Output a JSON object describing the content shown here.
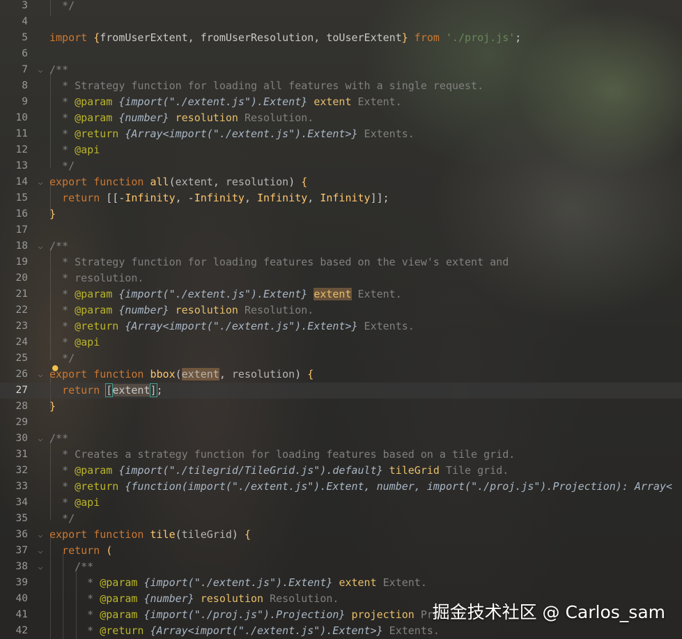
{
  "watermark": "掘金技术社区 @ Carlos_sam",
  "lines": [
    {
      "n": "3",
      "fold": "",
      "current": false,
      "html": "<span class=\"cm\">  */</span>"
    },
    {
      "n": "4",
      "fold": "",
      "current": false,
      "html": ""
    },
    {
      "n": "5",
      "fold": "",
      "current": false,
      "html": "<span class=\"kw\">import</span> <span class=\"fn\">{</span>fromUserExtent, fromUserResolution, toUserExtent<span class=\"fn\">}</span> <span class=\"kw\">from</span> <span class=\"str\">'./proj.js'</span>;"
    },
    {
      "n": "6",
      "fold": "",
      "current": false,
      "html": ""
    },
    {
      "n": "7",
      "fold": "⌵",
      "current": false,
      "html": "<span class=\"cm\">/**</span>"
    },
    {
      "n": "8",
      "fold": "",
      "current": false,
      "html": "<span class=\"cm\">  * Strategy function for loading all features with a single request.</span>"
    },
    {
      "n": "9",
      "fold": "",
      "current": false,
      "html": "<span class=\"cm\">  * </span><span class=\"tag\">@param</span> <span class=\"ty\">{import(\"./extent.js\").Extent}</span> <span class=\"pn\">extent</span> <span class=\"cm\">Extent.</span>"
    },
    {
      "n": "10",
      "fold": "",
      "current": false,
      "html": "<span class=\"cm\">  * </span><span class=\"tag\">@param</span> <span class=\"ty\">{number}</span> <span class=\"pn\">resolution</span> <span class=\"cm\">Resolution.</span>"
    },
    {
      "n": "11",
      "fold": "",
      "current": false,
      "html": "<span class=\"cm\">  * </span><span class=\"tag\">@return</span> <span class=\"ty\">{Array&lt;import(\"./extent.js\").Extent&gt;}</span> <span class=\"cm\">Extents.</span>"
    },
    {
      "n": "12",
      "fold": "",
      "current": false,
      "html": "<span class=\"cm\">  * </span><span class=\"tag\">@api</span>"
    },
    {
      "n": "13",
      "fold": "",
      "current": false,
      "html": "<span class=\"cm\">  */</span>"
    },
    {
      "n": "14",
      "fold": "⌵",
      "current": false,
      "html": "<span class=\"kw\">export</span> <span class=\"kw\">function</span> <span class=\"fn\">all</span>(<span class=\"par\">extent</span>, <span class=\"par\">resolution</span>) <span class=\"fn\">{</span>"
    },
    {
      "n": "15",
      "fold": "",
      "current": false,
      "html": "  <span class=\"kw\">return</span> [[-<span class=\"fn\">Infinity</span>, -<span class=\"fn\">Infinity</span>, <span class=\"fn\">Infinity</span>, <span class=\"fn\">Infinity</span>]];"
    },
    {
      "n": "16",
      "fold": "",
      "current": false,
      "html": "<span class=\"fn\">}</span>"
    },
    {
      "n": "17",
      "fold": "",
      "current": false,
      "html": ""
    },
    {
      "n": "18",
      "fold": "⌵",
      "current": false,
      "html": "<span class=\"cm\">/**</span>"
    },
    {
      "n": "19",
      "fold": "",
      "current": false,
      "html": "<span class=\"cm\">  * Strategy function for loading features based on the view's extent and</span>"
    },
    {
      "n": "20",
      "fold": "",
      "current": false,
      "html": "<span class=\"cm\">  * resolution.</span>"
    },
    {
      "n": "21",
      "fold": "",
      "current": false,
      "html": "<span class=\"cm\">  * </span><span class=\"tag\">@param</span> <span class=\"ty\">{import(\"./extent.js\").Extent}</span> <span class=\"pn hl\">extent</span> <span class=\"cm\">Extent.</span>"
    },
    {
      "n": "22",
      "fold": "",
      "current": false,
      "html": "<span class=\"cm\">  * </span><span class=\"tag\">@param</span> <span class=\"ty\">{number}</span> <span class=\"pn\">resolution</span> <span class=\"cm\">Resolution.</span>"
    },
    {
      "n": "23",
      "fold": "",
      "current": false,
      "html": "<span class=\"cm\">  * </span><span class=\"tag\">@return</span> <span class=\"ty\">{Array&lt;import(\"./extent.js\").Extent&gt;}</span> <span class=\"cm\">Extents.</span>"
    },
    {
      "n": "24",
      "fold": "",
      "current": false,
      "html": "<span class=\"cm\">  * </span><span class=\"tag\">@api</span>"
    },
    {
      "n": "25",
      "fold": "",
      "current": false,
      "html": "<span class=\"cm\">  */</span>"
    },
    {
      "n": "26",
      "fold": "⌵",
      "current": false,
      "html": "<span class=\"kw\">export</span> <span class=\"kw\">function</span> <span class=\"fn\">bbox</span>(<span class=\"par hl\">extent</span>, <span class=\"par\">resolution</span>) <span class=\"fn\">{</span>"
    },
    {
      "n": "27",
      "fold": "",
      "current": true,
      "html": "  <span class=\"kw\">return</span> <span class=\"br\">[</span><span class=\"bl\">extent</span><span class=\"br\">]</span>;"
    },
    {
      "n": "28",
      "fold": "",
      "current": false,
      "html": "<span class=\"fn\">}</span>"
    },
    {
      "n": "29",
      "fold": "",
      "current": false,
      "html": ""
    },
    {
      "n": "30",
      "fold": "⌵",
      "current": false,
      "html": "<span class=\"cm\">/**</span>"
    },
    {
      "n": "31",
      "fold": "",
      "current": false,
      "html": "<span class=\"cm\">  * Creates a strategy function for loading features based on a tile grid.</span>"
    },
    {
      "n": "32",
      "fold": "",
      "current": false,
      "html": "<span class=\"cm\">  * </span><span class=\"tag\">@param</span> <span class=\"ty\">{import(\"./tilegrid/TileGrid.js\").default}</span> <span class=\"pn\">tileGrid</span> <span class=\"cm\">Tile grid.</span>"
    },
    {
      "n": "33",
      "fold": "",
      "current": false,
      "html": "<span class=\"cm\">  * </span><span class=\"tag\">@return</span> <span class=\"ty\">{function(import(\"./extent.js\").Extent, number, import(\"./proj.js\").Projection): Array&lt;</span>"
    },
    {
      "n": "34",
      "fold": "",
      "current": false,
      "html": "<span class=\"cm\">  * </span><span class=\"tag\">@api</span>"
    },
    {
      "n": "35",
      "fold": "",
      "current": false,
      "html": "<span class=\"cm\">  */</span>"
    },
    {
      "n": "36",
      "fold": "⌵",
      "current": false,
      "html": "<span class=\"kw\">export</span> <span class=\"kw\">function</span> <span class=\"fn\">tile</span>(<span class=\"par\">tileGrid</span>) <span class=\"fn\">{</span>"
    },
    {
      "n": "37",
      "fold": "⌵",
      "current": false,
      "html": "  <span class=\"kw\">return</span> <span class=\"fn\">(</span>"
    },
    {
      "n": "38",
      "fold": "⌵",
      "current": false,
      "html": "<span class=\"cm\">    /**</span>"
    },
    {
      "n": "39",
      "fold": "",
      "current": false,
      "html": "<span class=\"cm\">      * </span><span class=\"tag\">@param</span> <span class=\"ty\">{import(\"./extent.js\").Extent}</span> <span class=\"pn\">extent</span> <span class=\"cm\">Extent.</span>"
    },
    {
      "n": "40",
      "fold": "",
      "current": false,
      "html": "<span class=\"cm\">      * </span><span class=\"tag\">@param</span> <span class=\"ty\">{number}</span> <span class=\"pn\">resolution</span> <span class=\"cm\">Resolution.</span>"
    },
    {
      "n": "41",
      "fold": "",
      "current": false,
      "html": "<span class=\"cm\">      * </span><span class=\"tag\">@param</span> <span class=\"ty\">{import(\"./proj.js\").Projection}</span> <span class=\"pn\">projection</span> <span class=\"cm\">Pro</span>"
    },
    {
      "n": "42",
      "fold": "",
      "current": false,
      "html": "<span class=\"cm\">      * </span><span class=\"tag\">@return</span> <span class=\"ty\">{Array&lt;import(\"./extent.js\").Extent&gt;}</span> <span class=\"cm\">Extents.</span>"
    }
  ]
}
